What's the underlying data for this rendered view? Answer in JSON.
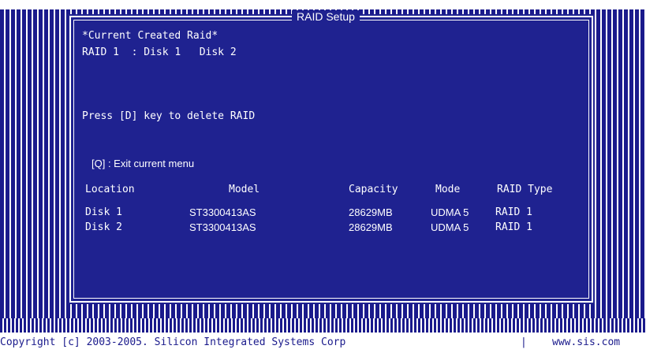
{
  "title": "RAID Setup",
  "current_raid": {
    "heading": "*Current Created Raid*",
    "summary": "RAID 1  : Disk 1   Disk 2"
  },
  "instructions": {
    "delete": "Press [D] key to delete RAID",
    "exit": "[Q] : Exit current menu"
  },
  "table": {
    "headers": [
      "Location",
      "Model",
      "Capacity",
      "Mode",
      "RAID Type"
    ],
    "rows": [
      [
        "Disk 1",
        "ST3300413AS",
        "28629MB",
        "UDMA 5",
        "RAID 1"
      ],
      [
        "Disk 2",
        "ST3300413AS",
        "28629MB",
        "UDMA 5",
        "RAID 1"
      ]
    ]
  },
  "footer": {
    "copyright": "Copyright [c] 2003-2005. Silicon Integrated Systems Corp",
    "separator": "|",
    "website": "www.sis.com"
  },
  "colors": {
    "background": "#1a1a8c",
    "text": "#ffffff"
  }
}
